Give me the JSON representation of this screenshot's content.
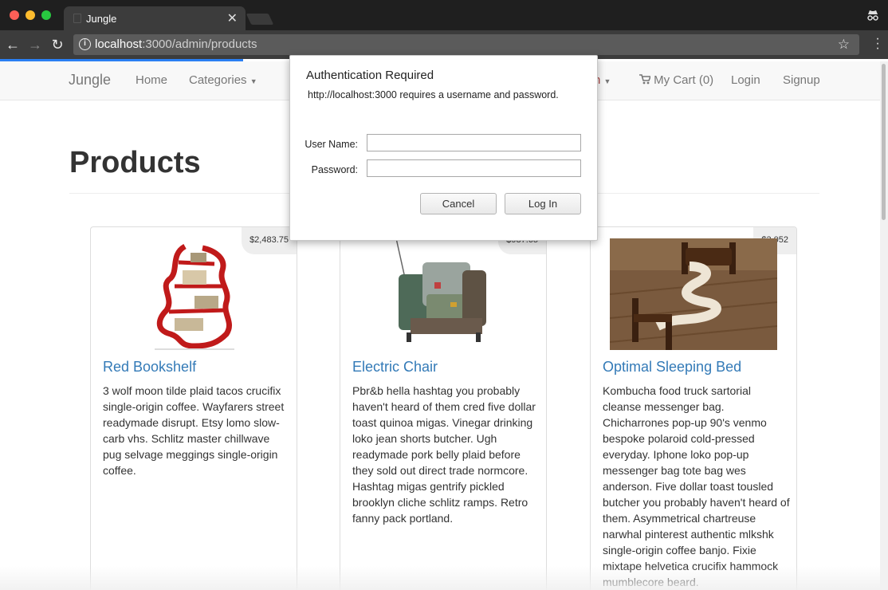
{
  "browser": {
    "tab_title": "Jungle",
    "tab_close": "✕",
    "url_host": "localhost",
    "url_rest": ":3000/admin/products",
    "icons": [
      "back-icon",
      "forward-icon",
      "reload-icon",
      "info-icon",
      "star-icon",
      "menu-icon",
      "incognito-icon"
    ]
  },
  "navbar": {
    "brand": "Jungle",
    "home": "Home",
    "categories": "Categories",
    "admin_partial": "n",
    "cart": "My Cart (0)",
    "login": "Login",
    "signup": "Signup"
  },
  "page": {
    "heading": "Products"
  },
  "products": [
    {
      "name": "Red Bookshelf",
      "price": "$2,483.75",
      "description": "3 wolf moon tilde plaid tacos crucifix single-origin coffee. Wayfarers street readymade disrupt. Etsy lomo slow-carb vhs. Schlitz master chillwave pug selvage meggings single-origin coffee."
    },
    {
      "name": "Electric Chair",
      "price": "$987.65",
      "description": "Pbr&b hella hashtag you probably haven't heard of them cred five dollar toast quinoa migas. Vinegar drinking loko jean shorts butcher. Ugh readymade pork belly plaid before they sold out direct trade normcore. Hashtag migas gentrify pickled brooklyn cliche schlitz ramps. Retro fanny pack portland."
    },
    {
      "name": "Optimal Sleeping Bed",
      "price": "$3,052",
      "description": "Kombucha food truck sartorial cleanse messenger bag. Chicharrones pop-up 90's venmo bespoke polaroid cold-pressed everyday. Iphone loko pop-up messenger bag tote bag wes anderson. Five dollar toast tousled butcher you probably haven't heard of them. Asymmetrical chartreuse narwhal pinterest authentic mlkshk single-origin coffee banjo. Fixie mixtape helvetica crucifix hammock mumblecore beard."
    }
  ],
  "auth_dialog": {
    "title": "Authentication Required",
    "message": "http://localhost:3000 requires a username and password.",
    "username_label": "User Name:",
    "password_label": "Password:",
    "username_value": "",
    "password_value": "",
    "cancel_label": "Cancel",
    "login_label": "Log In"
  },
  "colors": {
    "link": "#337ab7",
    "navbar_bg": "#f8f8f8",
    "chrome_dark": "#1f1f1f",
    "load_bar": "#2a7ff3"
  }
}
